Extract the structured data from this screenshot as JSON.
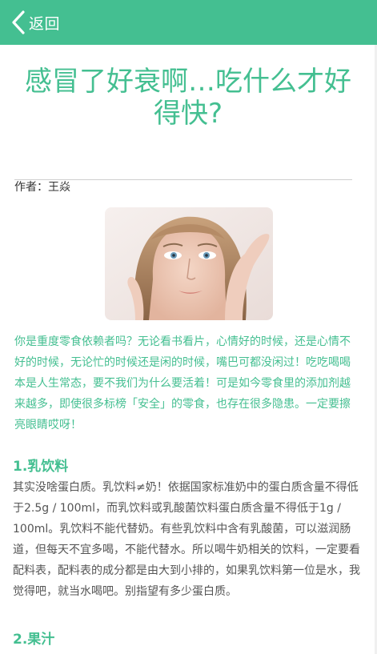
{
  "header": {
    "back_label": "返回",
    "accent_color": "#44bf91"
  },
  "article": {
    "title": "感冒了好衰啊…吃什么才好得快?",
    "author": "作者：王焱",
    "image_alt": "woman-face-photo",
    "intro": "你是重度零食依赖者吗？无论看书看片，心情好的时候，还是心情不好的时候，无论忙的时候还是闲的时候，嘴巴可都没闲过！吃吃喝喝本是人生常态，要不我们为什么要活着！可是如今零食里的添加剂越来越多，即使很多标榜「安全」的零食，也存在很多隐患。一定要擦亮眼睛哎呀！",
    "sections": [
      {
        "heading": "1.乳饮料",
        "body": "其实没啥蛋白质。乳饮料≠奶！依据国家标准奶中的蛋白质含量不得低于2.5g / 100ml，而乳饮料或乳酸菌饮料蛋白质含量不得低于1g / 100ml。乳饮料不能代替奶。有些乳饮料中含有乳酸菌，可以滋润肠道，但每天不宜多喝，不能代替水。所以喝牛奶相关的饮料，一定要看配料表，配料表的成分都是由大到小排的，如果乳饮料第一位是水，我觉得吧，就当水喝吧。别指望有多少蛋白质。"
      },
      {
        "heading": "2.果汁",
        "body": ""
      }
    ]
  }
}
